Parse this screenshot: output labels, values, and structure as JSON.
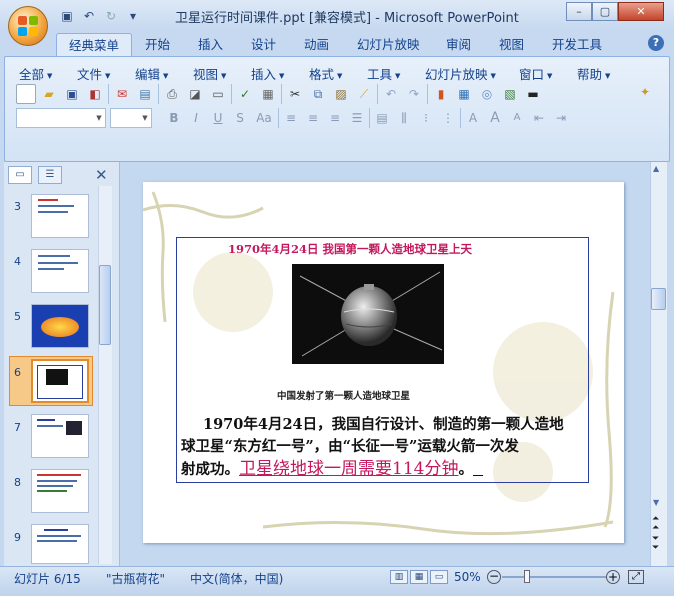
{
  "window": {
    "title": "卫星运行时间课件.ppt [兼容模式] - Microsoft PowerPoint",
    "controls": {
      "minimize": "–",
      "restore": "▢",
      "close": "✕"
    }
  },
  "quick_access": {
    "save_icon": "save-icon",
    "undo_icon": "undo-icon",
    "redo_icon": "redo-icon",
    "customize": "▾"
  },
  "tabs": [
    "经典菜单",
    "开始",
    "插入",
    "设计",
    "动画",
    "幻灯片放映",
    "审阅",
    "视图",
    "开发工具"
  ],
  "active_tab": "经典菜单",
  "menus": [
    "全部",
    "文件",
    "编辑",
    "视图",
    "插入",
    "格式",
    "工具",
    "幻灯片放映",
    "窗口",
    "帮助"
  ],
  "font_format_buttons": [
    "B",
    "I",
    "U",
    "S",
    "Aa"
  ],
  "font_size_buttons": [
    "A",
    "A",
    "A"
  ],
  "slides": {
    "numbers": [
      "3",
      "4",
      "5",
      "6",
      "7",
      "8",
      "9"
    ],
    "selected": "6"
  },
  "slide": {
    "heading": "1970年4月24日  我国第一颗人造地球卫星上天",
    "caption": "中国发射了第一颗人造地球卫星",
    "body_line1": "1970年4月24日，我国自行设计、制造的第一颗人造地",
    "body_line2": "球卫星“东方红一号”，由“长征一号”运载火箭一次发",
    "body_line3_prefix": "射成功。",
    "body_highlight": "卫星绕地球一周需要114分钟",
    "body_suffix": "。"
  },
  "status": {
    "slide_info": "幻灯片 6/15",
    "theme": "\"古瓶荷花\"",
    "language": "中文(简体，中国)",
    "zoom": "50%"
  },
  "colors": {
    "accent": "#15428b",
    "highlight": "#c4175c",
    "frame": "#2a3f9e"
  }
}
